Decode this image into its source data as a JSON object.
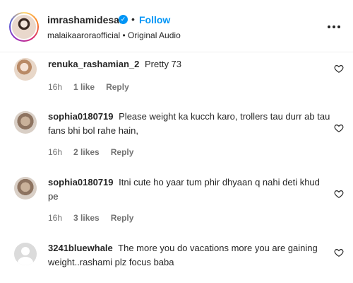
{
  "header": {
    "username": "imrashamidesai",
    "separator": "•",
    "follow_label": "Follow",
    "audio_line": "malaikaaroraofficial • Original Audio"
  },
  "comments": [
    {
      "username": "renuka_rashamian_2",
      "text": "Pretty 73",
      "time": "16h",
      "likes": "1 like",
      "reply": "Reply",
      "avatar": "photo-avatar"
    },
    {
      "username": "sophia0180719",
      "text": "Please weight ka kucch karo, trollers tau durr ab tau fans bhi bol rahe hain,",
      "time": "16h",
      "likes": "2 likes",
      "reply": "Reply",
      "avatar": "cat-avatar"
    },
    {
      "username": "sophia0180719",
      "text": "Itni cute ho yaar tum phir dhyaan q nahi deti khud pe",
      "time": "16h",
      "likes": "3 likes",
      "reply": "Reply",
      "avatar": "cat-avatar"
    },
    {
      "username": "3241bluewhale",
      "text": "The more you do vacations more you are gaining weight..rashami plz focus baba",
      "avatar": "default-avatar"
    }
  ],
  "colors": {
    "accent": "#0095f6",
    "text": "#262626",
    "muted": "#737373"
  },
  "icons": [
    "verified-badge-icon",
    "more-options-icon",
    "heart-icon"
  ]
}
